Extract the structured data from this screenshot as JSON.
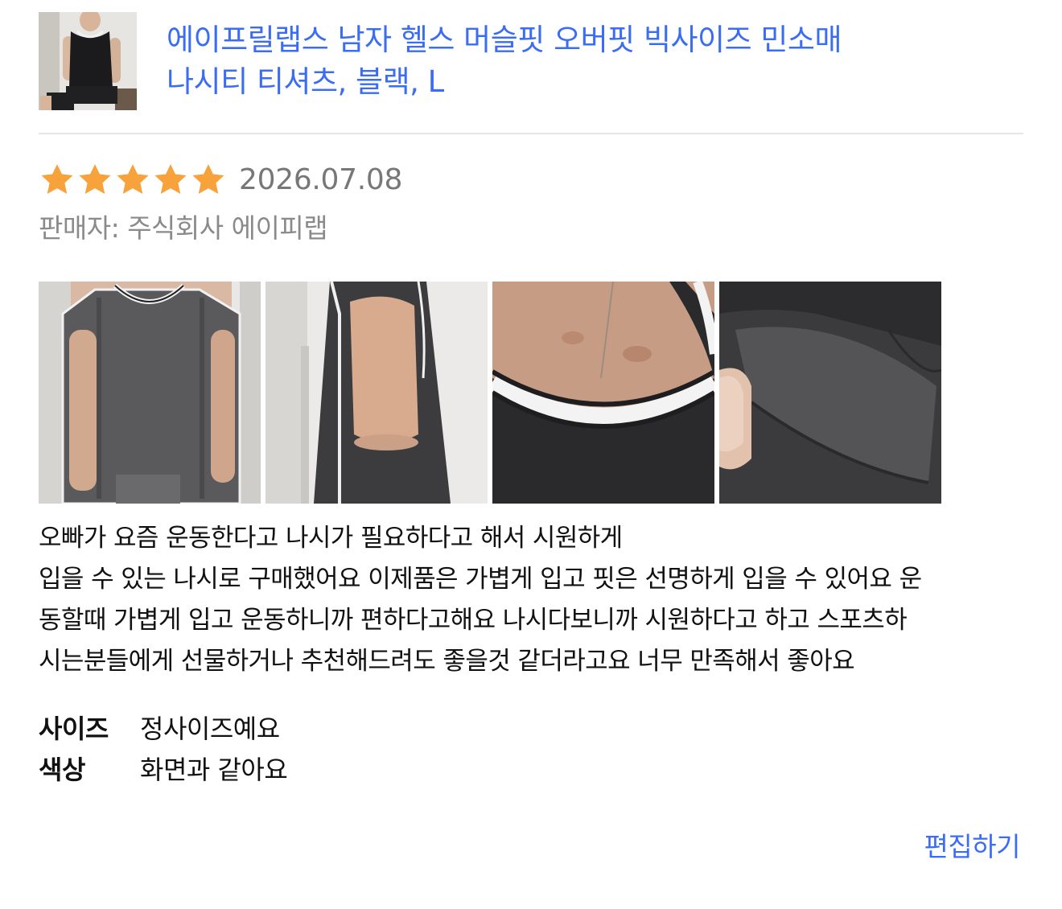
{
  "product": {
    "thumbnail_icon": "product-photo-man-black-tank-top",
    "title_line1": "에이프릴랩스 남자 헬스 머슬핏 오버핏 빅사이즈 민소매",
    "title_line2": "나시티 티셔츠, 블랙, L"
  },
  "review": {
    "rating": 5,
    "rating_max": 5,
    "star_icon": "star-filled-icon",
    "date": "2026.07.08",
    "seller": "판매자: 주식회사 에이피랩",
    "photos": [
      {
        "name": "photo-front-view",
        "description_icon": "tank-top-front-photo"
      },
      {
        "name": "photo-side-view",
        "description_icon": "tank-top-side-photo"
      },
      {
        "name": "photo-collar-closeup",
        "description_icon": "tank-top-collar-photo"
      },
      {
        "name": "photo-fabric-closeup",
        "description_icon": "tank-top-fabric-photo"
      }
    ],
    "body_lines": [
      "오빠가 요즘 운동한다고 나시가 필요하다고 해서 시원하게",
      "입을 수 있는 나시로 구매했어요 이제품은 가볍게 입고 핏은 선명하게 입을 수 있어요 운",
      "동할때 가볍게 입고 운동하니까 편하다고해요 나시다보니까 시원하다고 하고 스포츠하",
      "시는분들에게 선물하거나 추천해드려도 좋을것 같더라고요 너무 만족해서 좋아요"
    ],
    "attributes": {
      "size_label": "사이즈",
      "size_value": "정사이즈예요",
      "color_label": "색상",
      "color_value": "화면과 같아요"
    },
    "edit_label": "편집하기"
  },
  "colors": {
    "link_blue": "#3a6cf4",
    "star_orange": "#f7a23b",
    "meta_gray": "#8a8a8a",
    "divider": "#e6e6e6"
  }
}
